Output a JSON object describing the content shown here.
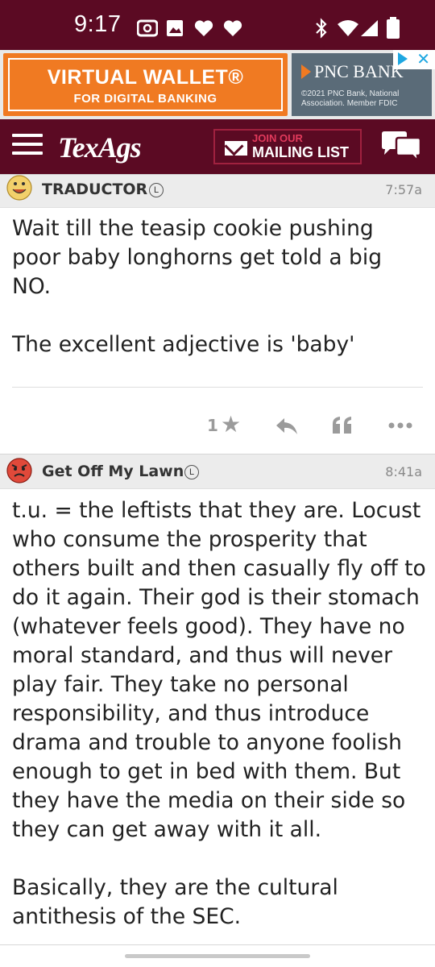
{
  "status_bar": {
    "time": "9:17",
    "icons": [
      "radio-icon",
      "image-icon",
      "heart-icon",
      "heart-icon",
      "bluetooth-icon",
      "wifi-icon",
      "signal-icon",
      "battery-icon"
    ]
  },
  "ad": {
    "title": "VIRTUAL WALLET®",
    "subtitle": "FOR DIGITAL BANKING",
    "brand": "PNC BANK",
    "legal": "©2021 PNC Bank, National Association. Member FDIC",
    "colors": {
      "orange": "#f07a22",
      "slate": "#5a6b78",
      "adchoices": "#1ea7e1"
    }
  },
  "header": {
    "logo": "TexAgs",
    "join_label": "JOIN OUR",
    "mailing_label": "MAILING LIST",
    "colors": {
      "maroon": "#5b0a23"
    }
  },
  "posts": [
    {
      "username": "TRADUCTOR",
      "badge": "L",
      "time": "7:57a",
      "avatar": "smiley-avatar",
      "body": "Wait till the teasip cookie pushing poor baby longhorns get told a big NO.\n\nThe excellent adjective is 'baby'",
      "likes": "1"
    },
    {
      "username": "Get Off My Lawn",
      "badge": "L",
      "time": "8:41a",
      "avatar": "angry-face-avatar",
      "body": "t.u. = the leftists that they are. Locust who consume the prosperity that others built and then casually fly off to do it again. Their god is their stomach (whatever feels good). They have no moral standard, and thus will never play fair. They take no personal responsibility, and thus introduce drama and trouble to anyone foolish enough to get in bed with them. But they have the media on their side so they can get away with it all.\n\nBasically, they are the cultural antithesis of the SEC."
    }
  ]
}
